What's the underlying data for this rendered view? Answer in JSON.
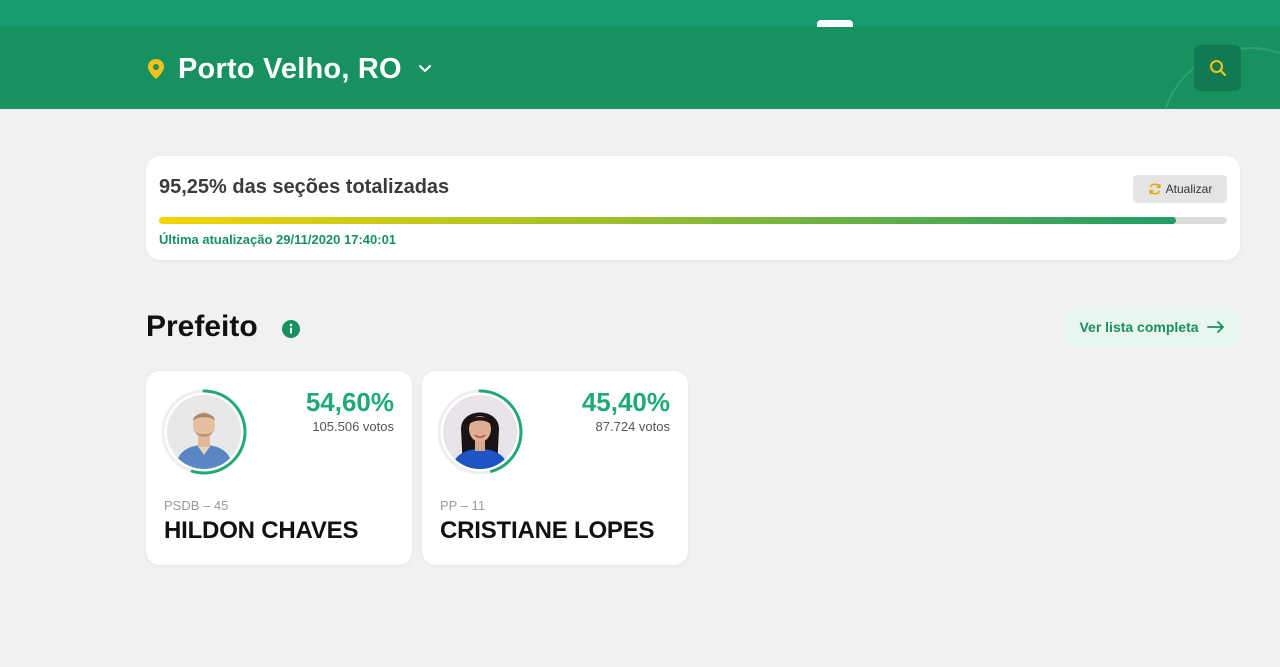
{
  "header": {
    "location_name": "Porto Velho, RO",
    "location_icon": "map-pin-icon",
    "dropdown_icon": "chevron-down-icon",
    "search_icon": "search-icon"
  },
  "status": {
    "title": "95,25% das seções totalizadas",
    "progress_percent": 95.25,
    "refresh_label": "Atualizar",
    "last_update": "Última atualização 29/11/2020 17:40:01"
  },
  "section": {
    "title": "Prefeito",
    "info_icon": "info-icon",
    "view_all_label": "Ver lista completa"
  },
  "candidates": [
    {
      "percent": "54,60%",
      "percent_value": 54.6,
      "votes": "105.506 votos",
      "party": "PSDB – 45",
      "name": "HILDON CHAVES"
    },
    {
      "percent": "45,40%",
      "percent_value": 45.4,
      "votes": "87.724 votos",
      "party": "PP – 11",
      "name": "CRISTIANE LOPES"
    }
  ],
  "colors": {
    "brand_green": "#17915f",
    "accent_green": "#1faa75",
    "accent_yellow": "#f4c21a",
    "background": "#f1f1f1"
  }
}
